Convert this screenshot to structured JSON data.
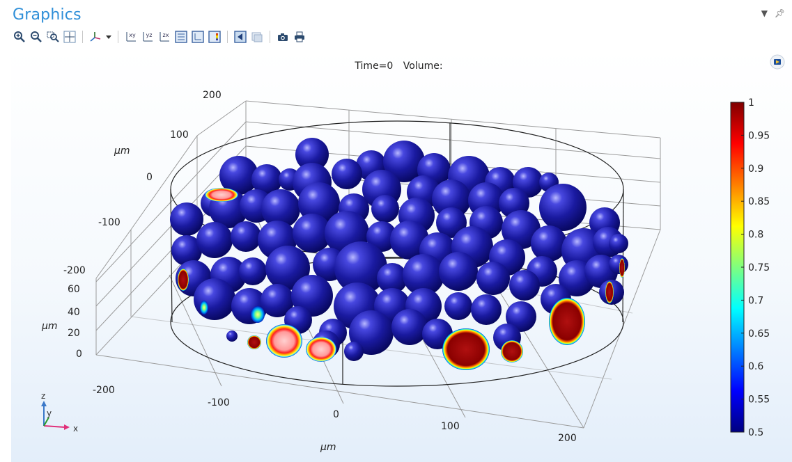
{
  "window": {
    "title": "Graphics",
    "menu_icon": "dropdown-arrow-icon",
    "pin_icon": "pin-icon"
  },
  "toolbar": {
    "buttons": [
      {
        "name": "zoom-in-button",
        "icon": "zoom-in-icon"
      },
      {
        "name": "zoom-out-button",
        "icon": "zoom-out-icon"
      },
      {
        "name": "zoom-box-button",
        "icon": "zoom-box-icon"
      },
      {
        "name": "zoom-extents-button",
        "icon": "zoom-extents-icon"
      },
      {
        "name": "view-axes-button",
        "icon": "axes-icon"
      },
      {
        "name": "view-xy-button",
        "label": "xy"
      },
      {
        "name": "view-yz-button",
        "label": "yz"
      },
      {
        "name": "view-zx-button",
        "label": "zx"
      },
      {
        "name": "show-grid-button",
        "icon": "grid-icon"
      },
      {
        "name": "show-axis-button",
        "icon": "axis-icon"
      },
      {
        "name": "show-legend-button",
        "icon": "legend-icon"
      },
      {
        "name": "transparency-button",
        "icon": "transparency-icon"
      },
      {
        "name": "wireframe-button",
        "icon": "wireframe-icon"
      },
      {
        "name": "camera-button",
        "icon": "camera-icon"
      },
      {
        "name": "print-button",
        "icon": "printer-icon"
      }
    ]
  },
  "plot": {
    "time_label": "Time=0",
    "title_label": "Volume:",
    "y_unit": "μm",
    "z_unit": "μm",
    "x_unit": "μm"
  },
  "axes": {
    "x_ticks": [
      "-200",
      "-100",
      "0",
      "100",
      "200"
    ],
    "y_ticks": [
      "200",
      "100",
      "0",
      "-100",
      "-200"
    ],
    "z_ticks": [
      "60",
      "40",
      "20",
      "0"
    ],
    "triad": {
      "z": "z",
      "y": "y",
      "x": "x"
    }
  },
  "colorbar": {
    "ticks": [
      "1",
      "0.95",
      "0.9",
      "0.85",
      "0.8",
      "0.75",
      "0.7",
      "0.65",
      "0.6",
      "0.55",
      "0.5"
    ],
    "min": 0.5,
    "max": 1,
    "colors": [
      "#00007f",
      "#0000ff",
      "#007fff",
      "#00ffff",
      "#7fff7f",
      "#ffff00",
      "#ff7f00",
      "#ff0000",
      "#7f0000"
    ]
  }
}
